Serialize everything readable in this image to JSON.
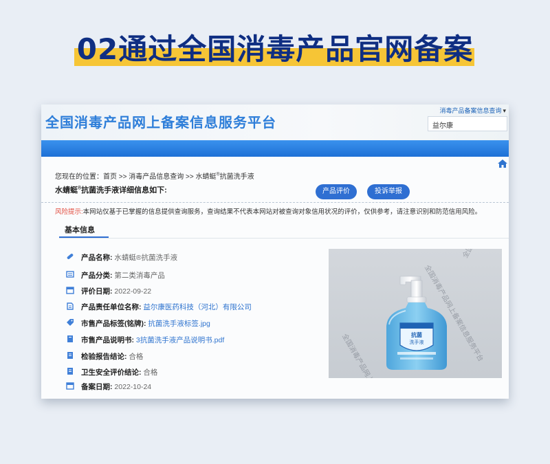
{
  "banner": {
    "title": "02通过全国消毒产品官网备案"
  },
  "site": {
    "title": "全国消毒产品网上备案信息服务平台",
    "dropdown_label": "消毒产品备案信息查询",
    "search_value": "益尔康"
  },
  "breadcrumb": {
    "prefix": "您现在的位置：",
    "home": "首页",
    "sep": " >> ",
    "level1": "消毒产品信息查询",
    "product_a": "水蜻蜓",
    "reg_mark": "®",
    "product_b": "抗菌洗手液"
  },
  "detail": {
    "name_a": "水蜻蜓",
    "reg_mark": "®",
    "name_b": "抗菌洗手液详细信息如下:"
  },
  "buttons": {
    "review": "产品评价",
    "complaint": "投诉举报"
  },
  "risk": {
    "label": "风险提示:",
    "text": "本网站仅基于已掌握的信息提供查询服务，查询结果不代表本网站对被查询对象信用状况的评价，仅供参考，请注意识别和防范信用风险。"
  },
  "tab": {
    "label": "基本信息"
  },
  "info": [
    {
      "icon": "pill-icon",
      "key": "产品名称:",
      "value": "水蜻蜓®抗菌洗手液",
      "link": false
    },
    {
      "icon": "category-icon",
      "key": "产品分类:",
      "value": "第二类消毒产品",
      "link": false
    },
    {
      "icon": "calendar-icon",
      "key": "评价日期:",
      "value": "2022-09-22",
      "link": false
    },
    {
      "icon": "building-icon",
      "key": "产品责任单位名称:",
      "value": "益尔康医药科技（河北）有限公司",
      "link": true
    },
    {
      "icon": "tag-icon",
      "key": "市售产品标签(铭牌):",
      "value": "抗菌洗手液标签.jpg",
      "link": true
    },
    {
      "icon": "book-icon",
      "key": "市售产品说明书:",
      "value": "3抗菌洗手液产品说明书.pdf",
      "link": true
    },
    {
      "icon": "report-icon",
      "key": "检验报告结论:",
      "value": "合格",
      "link": false
    },
    {
      "icon": "report-icon",
      "key": "卫生安全评价结论:",
      "value": "合格",
      "link": false
    },
    {
      "icon": "calendar-icon",
      "key": "备案日期:",
      "value": "2022-10-24",
      "link": false
    }
  ],
  "photo": {
    "bottle_label_line1": "抗菌",
    "bottle_label_line2": "洗手液",
    "watermark": "全国消毒产品网上备案信息服务平台"
  },
  "colors": {
    "brand_blue": "#2f6fd2",
    "banner_text": "#0f2e82",
    "banner_highlight": "#f6c536",
    "risk_label": "#e24c3f",
    "link": "#2f74cf"
  }
}
